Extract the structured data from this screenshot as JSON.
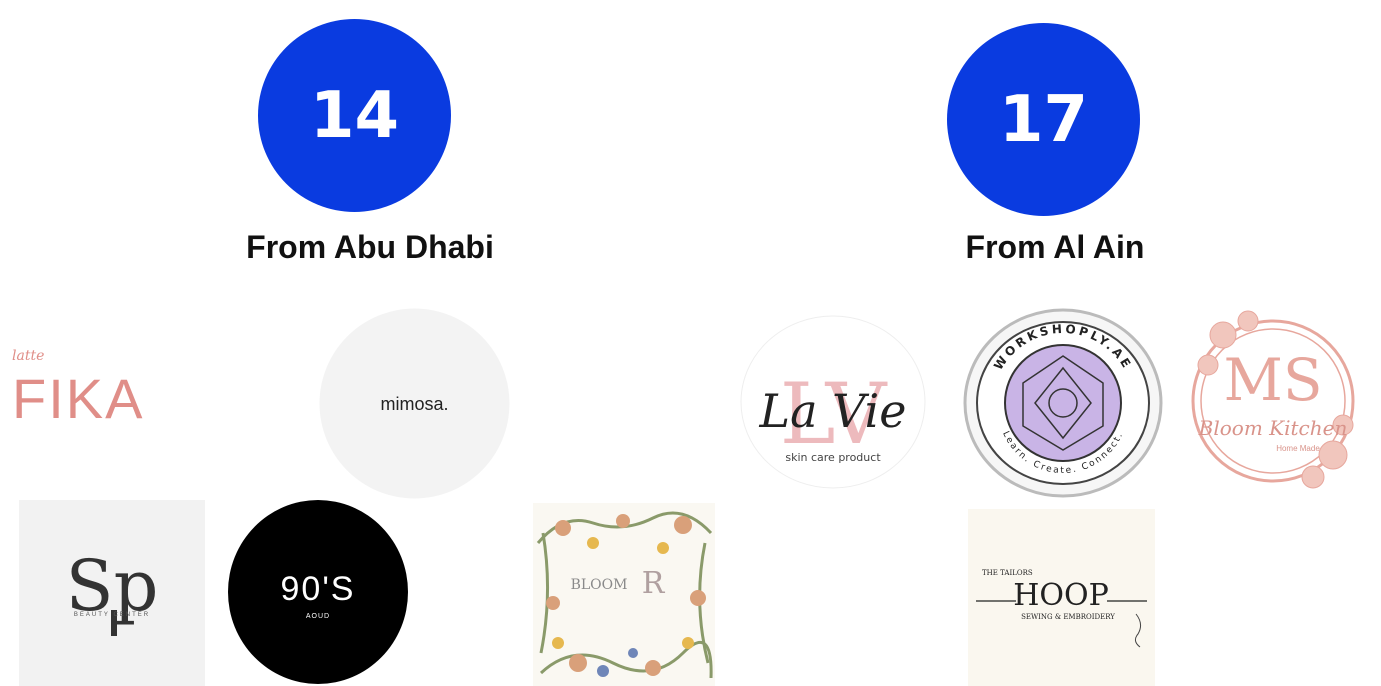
{
  "regions": [
    {
      "count": "14",
      "label": "From Abu Dhabi",
      "logos": [
        {
          "name": "FIKA",
          "top_text": "latte",
          "icon": "fika-logo"
        },
        {
          "name": "mimosa.",
          "icon": "mimosa-logo"
        },
        {
          "name": "Sp",
          "subtitle": "BEAUTY CENTER",
          "icon": "sp-beauty-center-logo"
        },
        {
          "name": "90'S",
          "subtitle": "AOUD",
          "icon": "90s-aoud-logo"
        },
        {
          "name": "BLOOM",
          "initial": "R",
          "icon": "bloom-floral-logo"
        }
      ]
    },
    {
      "count": "17",
      "label": "From Al Ain",
      "logos": [
        {
          "name": "La Vie",
          "subtitle": "skin care product",
          "monogram": "LV",
          "icon": "la-vie-logo"
        },
        {
          "name": "WORKSHOPLY.AE",
          "subtitle": "Learn. Create. Connect.",
          "icon": "workshoply-logo"
        },
        {
          "name": "Bloom Kitchen",
          "monogram": "MS",
          "subtitle": "Home Made",
          "icon": "ms-bloom-kitchen-logo"
        },
        {
          "name": "HOOP",
          "top_text": "THE TAILORS",
          "subtitle": "SEWING & EMBROIDERY",
          "icon": "tailors-hoop-logo"
        }
      ]
    }
  ],
  "colors": {
    "circle": "#0a3be0",
    "circle_text": "#ffffff",
    "label": "#111111",
    "fika": "#e08e88",
    "la_vie_pink": "#e8a3a8",
    "workshoply_purple": "#c9b4e6",
    "ms_pink": "#e7a79d"
  }
}
